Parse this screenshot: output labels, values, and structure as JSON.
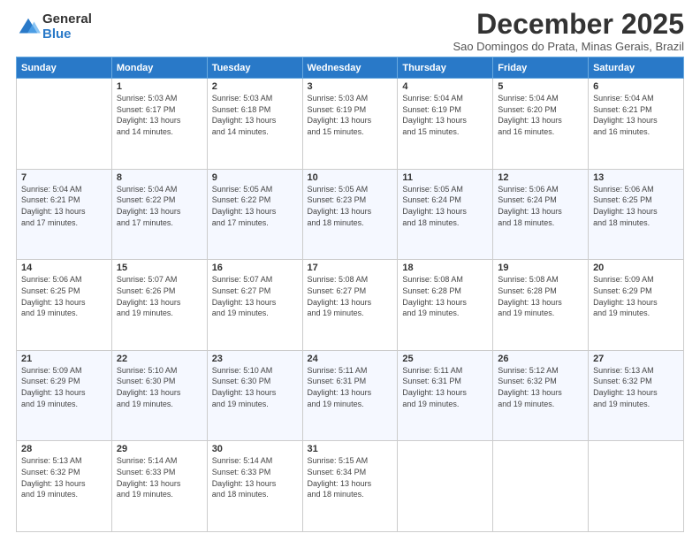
{
  "logo": {
    "general": "General",
    "blue": "Blue"
  },
  "header": {
    "month": "December 2025",
    "location": "Sao Domingos do Prata, Minas Gerais, Brazil"
  },
  "weekdays": [
    "Sunday",
    "Monday",
    "Tuesday",
    "Wednesday",
    "Thursday",
    "Friday",
    "Saturday"
  ],
  "weeks": [
    [
      {
        "day": "",
        "info": ""
      },
      {
        "day": "1",
        "info": "Sunrise: 5:03 AM\nSunset: 6:17 PM\nDaylight: 13 hours\nand 14 minutes."
      },
      {
        "day": "2",
        "info": "Sunrise: 5:03 AM\nSunset: 6:18 PM\nDaylight: 13 hours\nand 14 minutes."
      },
      {
        "day": "3",
        "info": "Sunrise: 5:03 AM\nSunset: 6:19 PM\nDaylight: 13 hours\nand 15 minutes."
      },
      {
        "day": "4",
        "info": "Sunrise: 5:04 AM\nSunset: 6:19 PM\nDaylight: 13 hours\nand 15 minutes."
      },
      {
        "day": "5",
        "info": "Sunrise: 5:04 AM\nSunset: 6:20 PM\nDaylight: 13 hours\nand 16 minutes."
      },
      {
        "day": "6",
        "info": "Sunrise: 5:04 AM\nSunset: 6:21 PM\nDaylight: 13 hours\nand 16 minutes."
      }
    ],
    [
      {
        "day": "7",
        "info": "Sunrise: 5:04 AM\nSunset: 6:21 PM\nDaylight: 13 hours\nand 17 minutes."
      },
      {
        "day": "8",
        "info": "Sunrise: 5:04 AM\nSunset: 6:22 PM\nDaylight: 13 hours\nand 17 minutes."
      },
      {
        "day": "9",
        "info": "Sunrise: 5:05 AM\nSunset: 6:22 PM\nDaylight: 13 hours\nand 17 minutes."
      },
      {
        "day": "10",
        "info": "Sunrise: 5:05 AM\nSunset: 6:23 PM\nDaylight: 13 hours\nand 18 minutes."
      },
      {
        "day": "11",
        "info": "Sunrise: 5:05 AM\nSunset: 6:24 PM\nDaylight: 13 hours\nand 18 minutes."
      },
      {
        "day": "12",
        "info": "Sunrise: 5:06 AM\nSunset: 6:24 PM\nDaylight: 13 hours\nand 18 minutes."
      },
      {
        "day": "13",
        "info": "Sunrise: 5:06 AM\nSunset: 6:25 PM\nDaylight: 13 hours\nand 18 minutes."
      }
    ],
    [
      {
        "day": "14",
        "info": "Sunrise: 5:06 AM\nSunset: 6:25 PM\nDaylight: 13 hours\nand 19 minutes."
      },
      {
        "day": "15",
        "info": "Sunrise: 5:07 AM\nSunset: 6:26 PM\nDaylight: 13 hours\nand 19 minutes."
      },
      {
        "day": "16",
        "info": "Sunrise: 5:07 AM\nSunset: 6:27 PM\nDaylight: 13 hours\nand 19 minutes."
      },
      {
        "day": "17",
        "info": "Sunrise: 5:08 AM\nSunset: 6:27 PM\nDaylight: 13 hours\nand 19 minutes."
      },
      {
        "day": "18",
        "info": "Sunrise: 5:08 AM\nSunset: 6:28 PM\nDaylight: 13 hours\nand 19 minutes."
      },
      {
        "day": "19",
        "info": "Sunrise: 5:08 AM\nSunset: 6:28 PM\nDaylight: 13 hours\nand 19 minutes."
      },
      {
        "day": "20",
        "info": "Sunrise: 5:09 AM\nSunset: 6:29 PM\nDaylight: 13 hours\nand 19 minutes."
      }
    ],
    [
      {
        "day": "21",
        "info": "Sunrise: 5:09 AM\nSunset: 6:29 PM\nDaylight: 13 hours\nand 19 minutes."
      },
      {
        "day": "22",
        "info": "Sunrise: 5:10 AM\nSunset: 6:30 PM\nDaylight: 13 hours\nand 19 minutes."
      },
      {
        "day": "23",
        "info": "Sunrise: 5:10 AM\nSunset: 6:30 PM\nDaylight: 13 hours\nand 19 minutes."
      },
      {
        "day": "24",
        "info": "Sunrise: 5:11 AM\nSunset: 6:31 PM\nDaylight: 13 hours\nand 19 minutes."
      },
      {
        "day": "25",
        "info": "Sunrise: 5:11 AM\nSunset: 6:31 PM\nDaylight: 13 hours\nand 19 minutes."
      },
      {
        "day": "26",
        "info": "Sunrise: 5:12 AM\nSunset: 6:32 PM\nDaylight: 13 hours\nand 19 minutes."
      },
      {
        "day": "27",
        "info": "Sunrise: 5:13 AM\nSunset: 6:32 PM\nDaylight: 13 hours\nand 19 minutes."
      }
    ],
    [
      {
        "day": "28",
        "info": "Sunrise: 5:13 AM\nSunset: 6:32 PM\nDaylight: 13 hours\nand 19 minutes."
      },
      {
        "day": "29",
        "info": "Sunrise: 5:14 AM\nSunset: 6:33 PM\nDaylight: 13 hours\nand 19 minutes."
      },
      {
        "day": "30",
        "info": "Sunrise: 5:14 AM\nSunset: 6:33 PM\nDaylight: 13 hours\nand 18 minutes."
      },
      {
        "day": "31",
        "info": "Sunrise: 5:15 AM\nSunset: 6:34 PM\nDaylight: 13 hours\nand 18 minutes."
      },
      {
        "day": "",
        "info": ""
      },
      {
        "day": "",
        "info": ""
      },
      {
        "day": "",
        "info": ""
      }
    ]
  ]
}
